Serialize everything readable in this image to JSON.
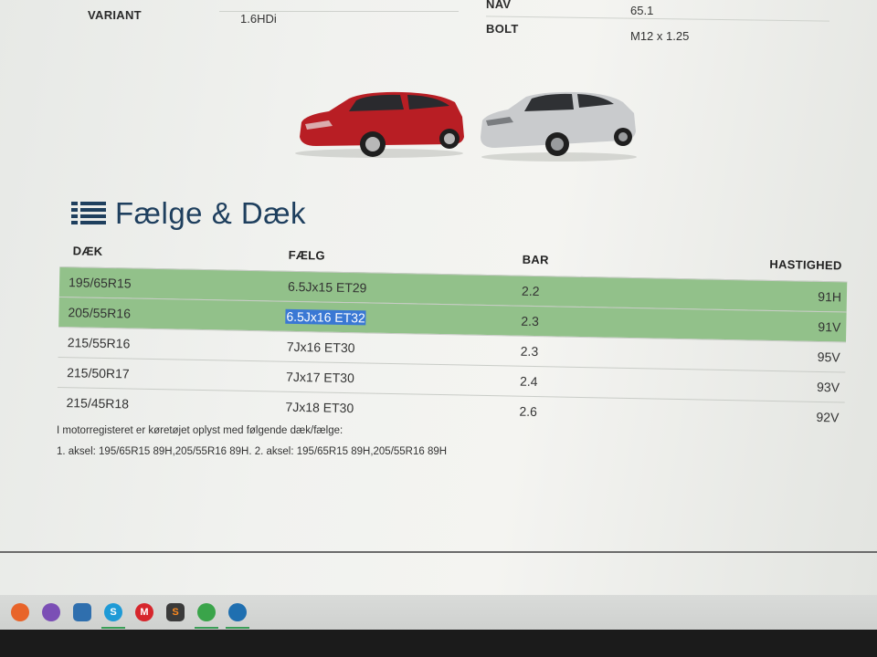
{
  "specs": {
    "variant_label": "VARIANT",
    "variant_value": "1.6HDi",
    "nav_label": "NAV",
    "nav_value": "65.1",
    "bolt_label": "BOLT",
    "bolt_value": "M12 x 1.25"
  },
  "cars": {
    "car1": "red hatchback",
    "car2": "silver sedan",
    "car1_color": "#b81e24",
    "car2_color": "#c9cbcd"
  },
  "section": {
    "icon": "list-icon",
    "title": "Fælge & Dæk"
  },
  "table": {
    "headers": {
      "tire": "DÆK",
      "rim": "FÆLG",
      "bar": "BAR",
      "speed": "HASTIGHED"
    },
    "rows": [
      {
        "tire": "195/65R15",
        "rim": "6.5Jx15 ET29",
        "bar": "2.2",
        "speed": "91H",
        "highlighted": true
      },
      {
        "tire": "205/55R16",
        "rim": "6.5Jx16 ET32",
        "bar": "2.3",
        "speed": "91V",
        "highlighted": true
      },
      {
        "tire": "215/55R16",
        "rim": "7Jx16 ET30",
        "bar": "2.3",
        "speed": "95V",
        "highlighted": false
      },
      {
        "tire": "215/50R17",
        "rim": "7Jx17 ET30",
        "bar": "2.4",
        "speed": "93V",
        "highlighted": false
      },
      {
        "tire": "215/45R18",
        "rim": "7Jx18 ET30",
        "bar": "2.6",
        "speed": "92V",
        "highlighted": false
      }
    ],
    "highlight_color": "#92c18a",
    "selection_color": "#3a78d4"
  },
  "note": {
    "line1": "I motorregisteret er køretøjet oplyst med følgende dæk/fælge:",
    "line2": "1. aksel: 195/65R15 89H,205/55R16 89H. 2. aksel: 195/65R15 89H,205/55R16 89H"
  },
  "taskbar": {
    "icons": [
      {
        "name": "firefox-icon",
        "glyph": "",
        "color": "#e8642a",
        "active": false
      },
      {
        "name": "viber-icon",
        "glyph": "",
        "color": "#7b4fb5",
        "active": false
      },
      {
        "name": "remote-desktop-icon",
        "glyph": "",
        "color": "#2f6fae",
        "active": false
      },
      {
        "name": "skype-icon",
        "glyph": "S",
        "color": "#1e9ad6",
        "active": true
      },
      {
        "name": "mail-icon",
        "glyph": "M",
        "color": "#d6262c",
        "active": false
      },
      {
        "name": "sublime-icon",
        "glyph": "S",
        "color": "#3a3a3a",
        "active": false
      },
      {
        "name": "xbox-icon",
        "glyph": "",
        "color": "#3aa44a",
        "active": true
      },
      {
        "name": "browser-icon",
        "glyph": "",
        "color": "#1f6fb0",
        "active": true
      }
    ]
  }
}
